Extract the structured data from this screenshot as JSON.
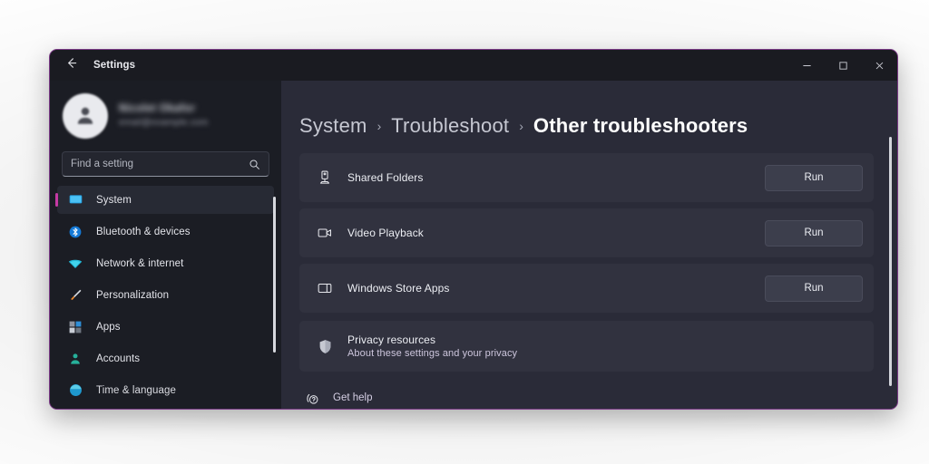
{
  "window": {
    "title": "Settings",
    "back_icon": "back-arrow-icon",
    "controls": {
      "minimize": "−",
      "maximize": "□",
      "close": "✕"
    },
    "border_color": "#7a3a86"
  },
  "sidebar": {
    "account": {
      "name": "Nicolet Okafor",
      "email": "email@example.com",
      "avatar_icon": "user-avatar-icon",
      "blurred": true
    },
    "search": {
      "placeholder": "Find a setting",
      "value": "",
      "icon": "search-icon"
    },
    "items": [
      {
        "label": "System",
        "icon": "monitor-icon",
        "selected": true
      },
      {
        "label": "Bluetooth & devices",
        "icon": "bluetooth-icon",
        "selected": false
      },
      {
        "label": "Network & internet",
        "icon": "wifi-icon",
        "selected": false
      },
      {
        "label": "Personalization",
        "icon": "paintbrush-icon",
        "selected": false
      },
      {
        "label": "Apps",
        "icon": "apps-grid-icon",
        "selected": false
      },
      {
        "label": "Accounts",
        "icon": "person-icon",
        "selected": false
      },
      {
        "label": "Time & language",
        "icon": "globe-clock-icon",
        "selected": false
      }
    ],
    "accent_color": "#c53aa4"
  },
  "content": {
    "breadcrumb": [
      {
        "label": "System",
        "current": false
      },
      {
        "label": "Troubleshoot",
        "current": false
      },
      {
        "label": "Other troubleshooters",
        "current": true
      }
    ],
    "breadcrumb_separator": "›",
    "troubleshooters": [
      {
        "name": "Shared Folders",
        "icon": "network-drive-icon",
        "action": "Run"
      },
      {
        "name": "Video Playback",
        "icon": "video-camera-icon",
        "action": "Run"
      },
      {
        "name": "Windows Store Apps",
        "icon": "store-app-icon",
        "action": "Run"
      }
    ],
    "privacy": {
      "title": "Privacy resources",
      "subtitle": "About these settings and your privacy",
      "icon": "shield-icon"
    },
    "get_help": {
      "label": "Get help",
      "icon": "help-question-icon"
    }
  }
}
